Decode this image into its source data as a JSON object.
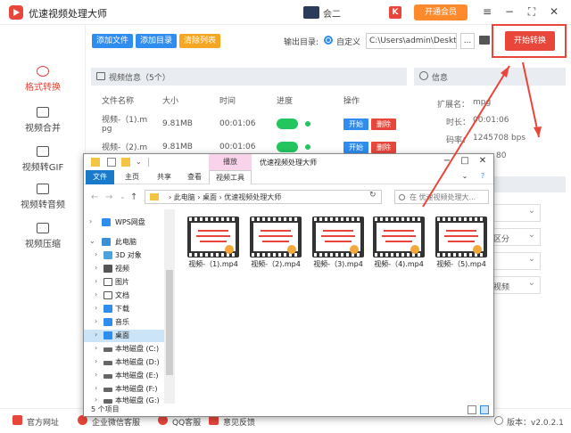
{
  "app": {
    "title": "优速视频处理大师",
    "user_name": "会二",
    "k_badge": "K",
    "vip_label": "开通会员",
    "window_controls": [
      "menu-icon",
      "minimize-icon",
      "maximize-icon",
      "close-icon"
    ]
  },
  "sidebar": {
    "items": [
      {
        "label": "格式转换",
        "icon": "convert-icon",
        "active": true
      },
      {
        "label": "视频合并",
        "icon": "merge-icon",
        "active": false
      },
      {
        "label": "视频转GIF",
        "icon": "gif-icon",
        "active": false
      },
      {
        "label": "视频转音频",
        "icon": "audio-icon",
        "active": false
      },
      {
        "label": "视频压缩",
        "icon": "compress-icon",
        "active": false
      }
    ]
  },
  "toolbar": {
    "add_file": "添加文件",
    "add_dir": "添加目录",
    "clear_list": "清除列表",
    "output_label": "输出目录:",
    "custom_label": "自定义",
    "output_path": "C:\\Users\\admin\\Deskto",
    "dots": "...",
    "start_label": "开始转换"
  },
  "video_list": {
    "header": "视频信息（5个）",
    "columns": [
      "文件名称",
      "大小",
      "时间",
      "进度",
      "操作"
    ],
    "rows": [
      {
        "name_line1": "视频-（1).m",
        "name_line2": "pg",
        "size": "9.81MB",
        "time": "00:01:06",
        "start": "开始",
        "delete": "删除"
      },
      {
        "name_line1": "视频-（2).m",
        "name_line2": "",
        "size": "9.81MB",
        "time": "00:01:06",
        "start": "开始",
        "delete": "删除"
      }
    ]
  },
  "info": {
    "header": "信息",
    "ext_label": "扩展名：",
    "ext_val": "mpg",
    "duration_label": "时长：",
    "duration_val": "00:01:06",
    "bitrate_label": "码率：",
    "bitrate_val": "1245708 bps",
    "partial_val": "80",
    "select_partial_1": "",
    "select_partial_2": "区分",
    "select_partial_3": "",
    "select_partial_4": "视频"
  },
  "footer": {
    "website": "官方网址",
    "wechat": "企业微信客服",
    "qq": "QQ客服",
    "feedback": "意见反馈",
    "version": "版本：v2.0.2.1"
  },
  "explorer": {
    "tools_tab": "播放",
    "window_title": "优速视频处理大师",
    "ribbon_tabs": [
      "文件",
      "主页",
      "共享",
      "查看",
      "视频工具"
    ],
    "address": "›  此电脑  ›  桌面  ›  优速视频处理大师",
    "search_placeholder": "在 优速视频处理大...",
    "nav_items": [
      {
        "label": "WPS网盘",
        "icon": "cloud-icon",
        "color": "#2e8def"
      },
      {
        "label": "此电脑",
        "icon": "computer-icon",
        "color": "#3a8fd6"
      },
      {
        "label": "3D 对象",
        "icon": "cube-icon",
        "color": "#4aa3df"
      },
      {
        "label": "视频",
        "icon": "video-folder-icon",
        "color": "#555555"
      },
      {
        "label": "图片",
        "icon": "picture-folder-icon",
        "color": "#555555"
      },
      {
        "label": "文档",
        "icon": "document-folder-icon",
        "color": "#555555"
      },
      {
        "label": "下载",
        "icon": "download-folder-icon",
        "color": "#2e8def"
      },
      {
        "label": "音乐",
        "icon": "music-folder-icon",
        "color": "#2e8def"
      },
      {
        "label": "桌面",
        "icon": "desktop-folder-icon",
        "color": "#2e8def"
      },
      {
        "label": "本地磁盘 (C:)",
        "icon": "drive-icon",
        "color": "#666666"
      },
      {
        "label": "本地磁盘 (D:)",
        "icon": "drive-icon",
        "color": "#666666"
      },
      {
        "label": "本地磁盘 (E:)",
        "icon": "drive-icon",
        "color": "#666666"
      },
      {
        "label": "本地磁盘 (F:)",
        "icon": "drive-icon",
        "color": "#666666"
      },
      {
        "label": "本地磁盘 (G:)",
        "icon": "drive-icon",
        "color": "#666666"
      }
    ],
    "files": [
      "视频-（1).mp4",
      "视频-（2).mp4",
      "视频-（3).mp4",
      "视频-（4).mp4",
      "视频-（5).mp4"
    ],
    "status": "5 个项目"
  },
  "colors": {
    "accent": "#e8463a",
    "blue": "#2e8def",
    "orange": "#f5a623",
    "green": "#22c55e"
  }
}
